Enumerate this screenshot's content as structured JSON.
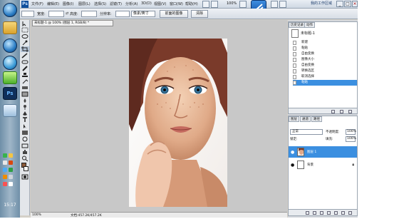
{
  "taskbar": {
    "clock": "15:17"
  },
  "menubar": {
    "logo": "Ps",
    "items": [
      "文件(F)",
      "编辑(E)",
      "图像(I)",
      "图层(L)",
      "选择(S)",
      "滤镜(T)",
      "分析(A)",
      "3D(D)",
      "视图(V)",
      "窗口(W)",
      "帮助(H)"
    ],
    "zoom": "100%",
    "workspace": "我的工作区域"
  },
  "options": {
    "width_label": "宽度:",
    "height_label": "高度:",
    "resolution_label": "分辨率:",
    "unit_value": "像素/英寸",
    "front_image_button": "前面的图像",
    "clear_button": "清除"
  },
  "document": {
    "tab_title": "未标题-1 @ 100% (图层 1, RGB/8) *",
    "status_zoom": "100%",
    "status_doc": "文档:457.2K/457.2K"
  },
  "history": {
    "tabs": [
      "历史记录",
      "动作"
    ],
    "snapshot_label": "未标题-1",
    "items": [
      "新建",
      "粘贴",
      "自由变换",
      "图像大小",
      "自由变换",
      "转换选区",
      "取消选择",
      "粘贴"
    ]
  },
  "layers": {
    "tabs": [
      "图层",
      "通道",
      "路径"
    ],
    "blend_mode": "正常",
    "opacity_label": "不透明度:",
    "opacity_value": "100%",
    "lock_label": "锁定:",
    "fill_label": "填充:",
    "fill_value": "100%",
    "rows": [
      {
        "name": "图层 1",
        "active": true
      },
      {
        "name": "背景",
        "active": false
      }
    ]
  },
  "colors": {
    "accent": "#3b8fe0",
    "canvas_bg": "#c8c8c8"
  }
}
